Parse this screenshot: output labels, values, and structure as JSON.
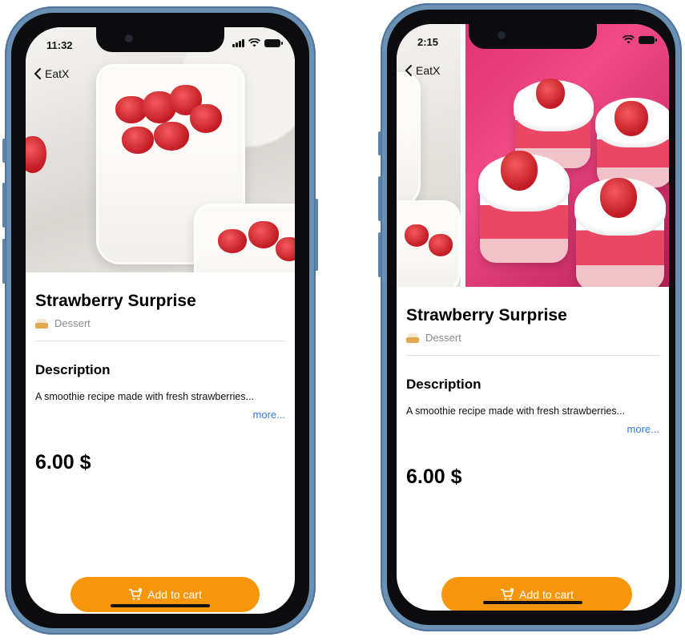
{
  "phones": [
    {
      "status_time": "11:32",
      "back_label": "EatX",
      "title": "Strawberry Surprise",
      "category": "Dessert",
      "description_heading": "Description",
      "description": "A smoothie recipe made with fresh strawberries...",
      "more_label": "more...",
      "price": "6.00 $",
      "cart_label": "Add to cart"
    },
    {
      "status_time": "2:15",
      "back_label": "EatX",
      "title": "Strawberry Surprise",
      "category": "Dessert",
      "description_heading": "Description",
      "description": "A smoothie recipe made with fresh strawberries...",
      "more_label": "more...",
      "price": "6.00 $",
      "cart_label": "Add to cart"
    }
  ],
  "colors": {
    "accent": "#f7960a",
    "link": "#2f7de1",
    "frame": "#6a90b4"
  },
  "icons": [
    "chevron-left-icon",
    "wifi-icon",
    "battery-icon",
    "cake-icon",
    "cart-icon"
  ]
}
